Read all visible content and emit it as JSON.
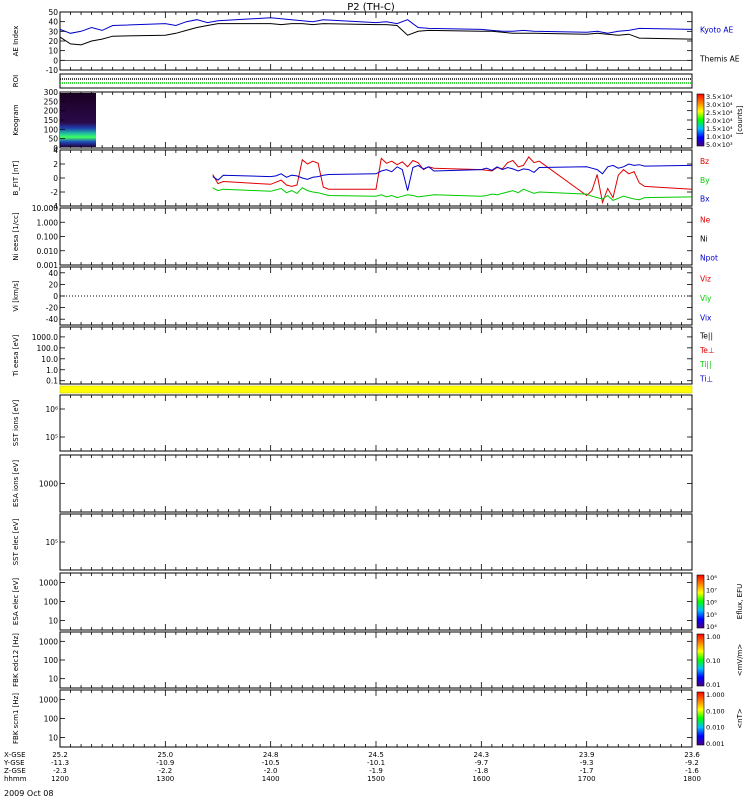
{
  "title": "P2 (TH-C)",
  "date_label": "2009 Oct 08",
  "colors": {
    "kyoto": "#0000cc",
    "themis": "#000000",
    "red": "#e00000",
    "green": "#00cc00",
    "blue": "#0000cc",
    "black": "#000000"
  },
  "chart_data": [
    {
      "type": "line",
      "name": "ae",
      "ylabel": "AE Index",
      "ylim": [
        -10,
        50
      ],
      "yticks": [
        "50",
        "40",
        "30",
        "20",
        "10",
        "0",
        "-10"
      ],
      "legend": [
        {
          "text": "Kyoto AE",
          "color": "kyoto"
        },
        {
          "text": "Themis AE",
          "color": "themis"
        }
      ],
      "series": [
        {
          "name": "Kyoto AE",
          "color": "kyoto",
          "x": [
            1200,
            1210,
            1220,
            1230,
            1240,
            1250,
            1300,
            1310,
            1320,
            1330,
            1340,
            1350,
            1400,
            1410,
            1420,
            1430,
            1440,
            1450,
            1500,
            1510,
            1520,
            1530,
            1540,
            1550,
            1600,
            1610,
            1620,
            1630,
            1640,
            1650,
            1700,
            1710,
            1720,
            1730,
            1740,
            1750,
            1800
          ],
          "y": [
            32,
            28,
            30,
            34,
            31,
            36,
            38,
            36,
            40,
            42,
            39,
            41,
            44,
            43,
            42,
            41,
            40,
            42,
            39,
            40,
            38,
            42,
            34,
            33,
            32,
            31,
            30,
            30,
            31,
            30,
            29,
            30,
            28,
            30,
            31,
            33,
            32
          ]
        },
        {
          "name": "Themis AE",
          "color": "themis",
          "x": [
            1200,
            1210,
            1220,
            1230,
            1240,
            1250,
            1300,
            1310,
            1320,
            1330,
            1340,
            1350,
            1400,
            1410,
            1420,
            1430,
            1440,
            1450,
            1500,
            1510,
            1520,
            1530,
            1540,
            1550,
            1600,
            1610,
            1620,
            1630,
            1640,
            1650,
            1700,
            1710,
            1720,
            1730,
            1740,
            1750,
            1800
          ],
          "y": [
            24,
            17,
            16,
            20,
            22,
            25,
            26,
            28,
            31,
            34,
            36,
            38,
            38,
            37,
            38,
            38,
            37,
            38,
            37,
            37,
            36,
            26,
            30,
            31,
            30,
            30,
            29,
            28,
            28,
            28,
            27,
            28,
            27,
            26,
            27,
            23,
            22
          ]
        }
      ]
    },
    {
      "type": "area",
      "name": "roi",
      "ylabel": "ROI",
      "bands": [
        "black",
        "green"
      ]
    },
    {
      "type": "heatmap",
      "name": "keogram",
      "ylabel": "Keogram",
      "ylim": [
        0,
        300
      ],
      "yticks": [
        "300",
        "250",
        "200",
        "150",
        "100",
        "50",
        "0"
      ],
      "x_range": [
        1200,
        1210
      ],
      "colorbar": {
        "label": "[counts]",
        "ticks": [
          "3.5×10⁴",
          "3.0×10⁴",
          "2.5×10⁴",
          "2.0×10⁴",
          "1.5×10⁴",
          "1.0×10⁴",
          "5.0×10³"
        ]
      }
    },
    {
      "type": "line",
      "name": "bfield",
      "ylabel": "B_FIT [nT]",
      "ylim": [
        -4,
        4
      ],
      "yticks": [
        "4",
        "2",
        "0",
        "-2",
        "-4"
      ],
      "legend": [
        {
          "text": "Bz",
          "color": "red"
        },
        {
          "text": "By",
          "color": "green"
        },
        {
          "text": "Bx",
          "color": "blue"
        }
      ],
      "series": [
        {
          "name": "Bz",
          "color": "red",
          "x": [
            1345,
            1350,
            1355,
            1400,
            1405,
            1410,
            1415,
            1420,
            1425,
            1430,
            1435,
            1440,
            1445,
            1450,
            1455,
            1500,
            1505,
            1510,
            1515,
            1520,
            1525,
            1530,
            1535,
            1540,
            1545,
            1550,
            1555,
            1600,
            1605,
            1610,
            1615,
            1620,
            1625,
            1630,
            1635,
            1640,
            1645,
            1650,
            1655,
            1700,
            1705,
            1710,
            1715,
            1720,
            1725,
            1730,
            1735,
            1740,
            1745,
            1750,
            1755,
            1800
          ],
          "y": [
            0.5,
            -0.8,
            -0.5,
            -0.9,
            -0.6,
            -0.3,
            -1.0,
            -1.2,
            -1.0,
            2.6,
            2.0,
            2.4,
            2.1,
            -1.3,
            -1.6,
            -1.6,
            2.8,
            2.1,
            2.4,
            1.9,
            2.3,
            1.6,
            2.5,
            2.2,
            1.2,
            1.6,
            1.4,
            1.2,
            1.1,
            1.0,
            1.5,
            1.3,
            2.2,
            2.5,
            1.6,
            1.8,
            3.0,
            2.2,
            2.4,
            -2.5,
            -1.8,
            0.5,
            -3.5,
            -1.5,
            -2.8,
            0.4,
            1.2,
            0.6,
            0.9,
            -0.7,
            -1.2,
            -1.6
          ]
        },
        {
          "name": "By",
          "color": "green",
          "x": [
            1345,
            1350,
            1355,
            1400,
            1405,
            1410,
            1415,
            1420,
            1425,
            1430,
            1435,
            1440,
            1445,
            1450,
            1455,
            1500,
            1505,
            1510,
            1515,
            1520,
            1525,
            1530,
            1535,
            1540,
            1545,
            1550,
            1555,
            1600,
            1605,
            1610,
            1615,
            1620,
            1625,
            1630,
            1635,
            1640,
            1645,
            1650,
            1655,
            1700,
            1705,
            1710,
            1715,
            1720,
            1725,
            1730,
            1735,
            1740,
            1745,
            1750,
            1755,
            1800
          ],
          "y": [
            -1.4,
            -1.8,
            -1.6,
            -1.9,
            -1.7,
            -1.5,
            -2.1,
            -1.8,
            -2.2,
            -1.4,
            -1.8,
            -2.0,
            -2.1,
            -2.3,
            -2.5,
            -2.6,
            -2.4,
            -2.7,
            -2.5,
            -2.8,
            -2.6,
            -2.4,
            -2.5,
            -2.7,
            -2.6,
            -2.5,
            -2.4,
            -2.6,
            -2.5,
            -2.3,
            -2.4,
            -2.2,
            -2.0,
            -1.8,
            -2.1,
            -1.6,
            -1.9,
            -2.2,
            -2.0,
            -2.3,
            -2.6,
            -2.8,
            -3.0,
            -2.5,
            -3.2,
            -2.9,
            -2.6,
            -2.8,
            -3.0,
            -3.1,
            -2.8,
            -2.7
          ]
        },
        {
          "name": "Bx",
          "color": "blue",
          "x": [
            1345,
            1350,
            1355,
            1400,
            1405,
            1410,
            1415,
            1420,
            1425,
            1430,
            1435,
            1440,
            1445,
            1450,
            1455,
            1500,
            1505,
            1510,
            1515,
            1520,
            1525,
            1530,
            1535,
            1540,
            1545,
            1550,
            1555,
            1600,
            1605,
            1610,
            1615,
            1620,
            1625,
            1630,
            1635,
            1640,
            1645,
            1650,
            1655,
            1700,
            1705,
            1710,
            1715,
            1720,
            1725,
            1730,
            1735,
            1740,
            1745,
            1750,
            1755,
            1800
          ],
          "y": [
            0.2,
            -0.3,
            0.4,
            0.2,
            0.3,
            0.6,
            0.1,
            0.4,
            0.3,
            0.0,
            -0.2,
            0.1,
            0.2,
            0.4,
            0.5,
            0.6,
            1.0,
            1.2,
            0.9,
            1.6,
            1.2,
            -1.8,
            1.5,
            1.8,
            1.3,
            1.6,
            1.0,
            1.2,
            1.4,
            1.1,
            1.6,
            1.2,
            1.5,
            1.3,
            1.0,
            1.3,
            1.2,
            0.8,
            1.5,
            1.6,
            1.4,
            1.2,
            0.6,
            1.6,
            1.8,
            1.4,
            1.6,
            2.0,
            1.8,
            1.9,
            1.7,
            1.8
          ]
        }
      ]
    },
    {
      "type": "line",
      "name": "density",
      "ylabel": "Ni eesa [1/cc]",
      "yscale": "log",
      "ylim": [
        0.001,
        10
      ],
      "yticks": [
        "10.000",
        "1.000",
        "0.100",
        "0.010",
        "0.001"
      ],
      "legend": [
        {
          "text": "Ne",
          "color": "red"
        },
        {
          "text": "Ni",
          "color": "black"
        },
        {
          "text": "Npot",
          "color": "blue"
        }
      ],
      "series": []
    },
    {
      "type": "line",
      "name": "velocity",
      "ylabel": "Vi [km/s]",
      "ylim": [
        -50,
        50
      ],
      "yticks": [
        "40",
        "20",
        "0",
        "-20",
        "-40"
      ],
      "legend": [
        {
          "text": "Viz",
          "color": "red"
        },
        {
          "text": "Viy",
          "color": "green"
        },
        {
          "text": "Vix",
          "color": "blue"
        }
      ],
      "series": []
    },
    {
      "type": "line",
      "name": "temperature",
      "ylabel": "Ti eesa [eV]",
      "yscale": "log",
      "ylim": [
        0.05,
        8000
      ],
      "yticks": [
        "1000.0",
        "100.0",
        "10.0",
        "1.0",
        "0.1"
      ],
      "legend": [
        {
          "text": "Te||",
          "color": "black"
        },
        {
          "text": "Te⊥",
          "color": "red"
        },
        {
          "text": "Ti||",
          "color": "green"
        },
        {
          "text": "Ti⊥",
          "color": "blue"
        }
      ],
      "series": []
    },
    {
      "type": "area",
      "name": "mode_bar",
      "bands": [
        "yellow"
      ]
    },
    {
      "type": "heatmap",
      "name": "sst_i",
      "ylabel": "SST ions [eV]",
      "yticks": [
        "10⁶",
        "10⁵"
      ]
    },
    {
      "type": "heatmap",
      "name": "esa_i",
      "ylabel": "ESA ions [eV]",
      "yticks": [
        "1000"
      ]
    },
    {
      "type": "heatmap",
      "name": "sst_e",
      "ylabel": "SST elec [eV]",
      "yticks": [
        "10⁵"
      ]
    },
    {
      "type": "heatmap",
      "name": "esa_e",
      "ylabel": "ESA elec [eV]",
      "yticks": [
        "1000",
        "100",
        "10"
      ],
      "colorbar": {
        "label": "Eflux, EFU",
        "ticks": [
          "10⁸",
          "10⁷",
          "10⁶",
          "10⁵",
          "10⁴"
        ]
      }
    },
    {
      "type": "heatmap",
      "name": "fbk_e",
      "ylabel": "FBK edc12 [Hz]",
      "yticks": [
        "1000",
        "100",
        "10"
      ],
      "colorbar": {
        "label": "<mV/m>",
        "ticks": [
          "1.00",
          "0.10",
          "0.01"
        ]
      }
    },
    {
      "type": "heatmap",
      "name": "fbk_b",
      "ylabel": "FBK scm1 [Hz]",
      "yticks": [
        "1000",
        "100",
        "10"
      ],
      "colorbar": {
        "label": "<nT>",
        "ticks": [
          "1.000",
          "0.100",
          "0.010",
          "0.001"
        ]
      }
    }
  ],
  "x_axis": {
    "range": [
      1200,
      1800
    ],
    "major": [
      1200,
      1300,
      1400,
      1500,
      1600,
      1700,
      1800
    ],
    "row_labels": [
      "X-GSE",
      "Y-GSE",
      "Z-GSE",
      "hhmm"
    ],
    "rows": [
      [
        "25.2",
        "25.0",
        "24.8",
        "24.5",
        "24.3",
        "23.9",
        "23.6"
      ],
      [
        "-11.3",
        "-10.9",
        "-10.5",
        "-10.1",
        "-9.7",
        "-9.3",
        "-9.2"
      ],
      [
        "-2.3",
        "-2.2",
        "-2.0",
        "-1.9",
        "-1.8",
        "-1.7",
        "-1.6"
      ],
      [
        "1200",
        "1300",
        "1400",
        "1500",
        "1600",
        "1700",
        "1800"
      ]
    ]
  }
}
